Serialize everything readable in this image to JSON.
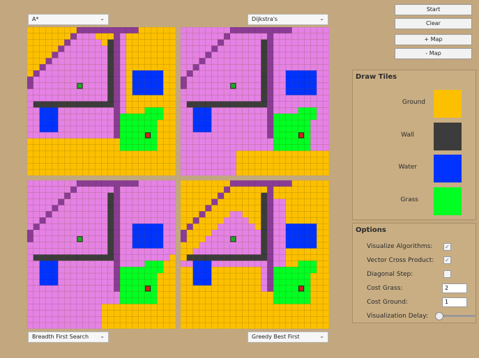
{
  "selectors": {
    "top_left": "A*",
    "top_right": "Dijkstra's",
    "bottom_left": "Breadth First Search",
    "bottom_right": "Greedy Best First"
  },
  "buttons": {
    "start": "Start",
    "clear": "Clear",
    "add_map": "+ Map",
    "remove_map": "- Map"
  },
  "draw_tiles": {
    "title": "Draw Tiles",
    "tiles": [
      {
        "label": "Ground",
        "color": "#fcc000"
      },
      {
        "label": "Wall",
        "color": "#3c3c3c"
      },
      {
        "label": "Water",
        "color": "#0033ff"
      },
      {
        "label": "Grass",
        "color": "#00ff22"
      }
    ]
  },
  "options": {
    "title": "Options",
    "visualize_algorithms": {
      "label": "Visualize Algorithms:",
      "checked": true
    },
    "vector_cross_product": {
      "label": "Vector Cross Product:",
      "checked": true
    },
    "diagonal_step": {
      "label": "Diagonal Step:",
      "checked": false
    },
    "cost_grass": {
      "label": "Cost Grass:",
      "value": "2"
    },
    "cost_ground": {
      "label": "Cost Ground:",
      "value": "1"
    },
    "visualization_delay": {
      "label": "Visualization Delay:",
      "level": 0
    }
  },
  "grid_colors": {
    "ground": "#fcc000",
    "wall": "#3c3c3c",
    "water": "#0033ff",
    "grass": "#00ff22",
    "visited": "#e582e5",
    "path": "#8a3c96"
  }
}
